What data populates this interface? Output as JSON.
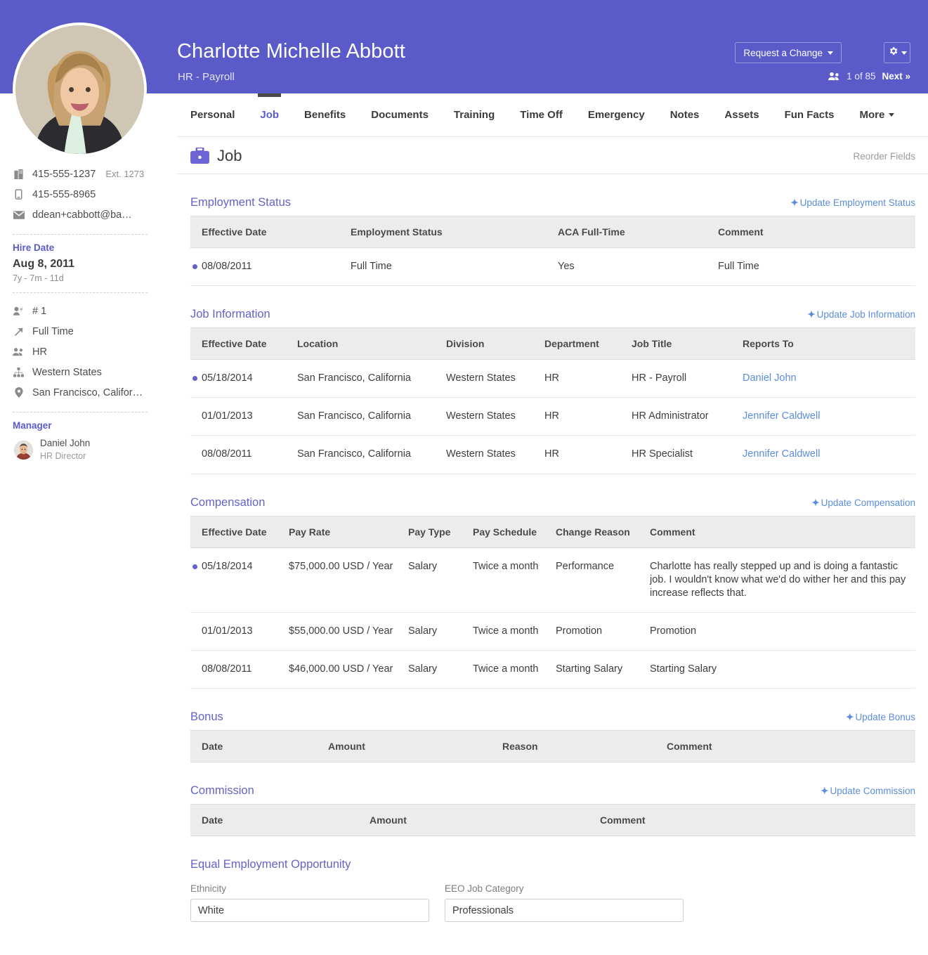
{
  "header": {
    "name": "Charlotte Michelle Abbott",
    "subtitle": "HR - Payroll",
    "request_change_label": "Request a Change",
    "gear_icon": "gear-icon",
    "people_icon": "people-icon",
    "record_count": "1 of 85",
    "next_label": "Next »",
    "band_color": "#5a5ac9"
  },
  "sidebar": {
    "work_phone": "415-555-1237",
    "work_phone_ext": "Ext. 1273",
    "mobile_phone": "415-555-8965",
    "email": "ddean+cabbott@ba…",
    "hire_date_label": "Hire Date",
    "hire_date": "Aug 8, 2011",
    "tenure": "7y - 7m - 11d",
    "employee_number": "# 1",
    "employment_type": "Full Time",
    "department": "HR",
    "division": "Western States",
    "location": "San Francisco, Califor…",
    "manager_label": "Manager",
    "manager_name": "Daniel John",
    "manager_title": "HR Director",
    "icons": {
      "work_phone": "office-phone-icon",
      "mobile_phone": "mobile-phone-icon",
      "email": "envelope-icon",
      "employee_number": "person-number-icon",
      "employment_type": "arrow-up-right-icon",
      "department": "people-icon",
      "division": "org-chart-icon",
      "location": "map-pin-icon"
    }
  },
  "tabs": [
    {
      "label": "Personal",
      "active": false
    },
    {
      "label": "Job",
      "active": true
    },
    {
      "label": "Benefits",
      "active": false
    },
    {
      "label": "Documents",
      "active": false
    },
    {
      "label": "Training",
      "active": false
    },
    {
      "label": "Time Off",
      "active": false
    },
    {
      "label": "Emergency",
      "active": false
    },
    {
      "label": "Notes",
      "active": false
    },
    {
      "label": "Assets",
      "active": false
    },
    {
      "label": "Fun Facts",
      "active": false
    },
    {
      "label": "More",
      "active": false
    }
  ],
  "page_header": {
    "icon": "briefcase-icon",
    "title": "Job",
    "reorder_label": "Reorder Fields"
  },
  "employment_status": {
    "title": "Employment Status",
    "action": "Update Employment Status",
    "columns": [
      "Effective Date",
      "Employment Status",
      "ACA Full-Time",
      "Comment"
    ],
    "rows": [
      {
        "current": true,
        "cells": [
          "08/08/2011",
          "Full Time",
          "Yes",
          "Full Time"
        ]
      }
    ]
  },
  "job_information": {
    "title": "Job Information",
    "action": "Update Job Information",
    "columns": [
      "Effective Date",
      "Location",
      "Division",
      "Department",
      "Job Title",
      "Reports To"
    ],
    "rows": [
      {
        "current": true,
        "cells": [
          "05/18/2014",
          "San Francisco, California",
          "Western States",
          "HR",
          "HR - Payroll",
          "Daniel John"
        ]
      },
      {
        "current": false,
        "cells": [
          "01/01/2013",
          "San Francisco, California",
          "Western States",
          "HR",
          "HR Administrator",
          "Jennifer Caldwell"
        ]
      },
      {
        "current": false,
        "cells": [
          "08/08/2011",
          "San Francisco, California",
          "Western States",
          "HR",
          "HR Specialist",
          "Jennifer Caldwell"
        ]
      }
    ]
  },
  "compensation": {
    "title": "Compensation",
    "action": "Update Compensation",
    "columns": [
      "Effective Date",
      "Pay Rate",
      "Pay Type",
      "Pay Schedule",
      "Change Reason",
      "Comment"
    ],
    "rows": [
      {
        "current": true,
        "cells": [
          "05/18/2014",
          "$75,000.00 USD / Year",
          "Salary",
          "Twice a month",
          "Performance",
          "Charlotte has really stepped up and is doing a fantastic job. I wouldn't know what we'd do wither her and this pay increase reflects that."
        ]
      },
      {
        "current": false,
        "cells": [
          "01/01/2013",
          "$55,000.00 USD / Year",
          "Salary",
          "Twice a month",
          "Promotion",
          "Promotion"
        ]
      },
      {
        "current": false,
        "cells": [
          "08/08/2011",
          "$46,000.00 USD / Year",
          "Salary",
          "Twice a month",
          "Starting Salary",
          "Starting Salary"
        ]
      }
    ]
  },
  "bonus": {
    "title": "Bonus",
    "action": "Update Bonus",
    "columns": [
      "Date",
      "Amount",
      "Reason",
      "Comment"
    ],
    "rows": []
  },
  "commission": {
    "title": "Commission",
    "action": "Update Commission",
    "columns": [
      "Date",
      "Amount",
      "Comment"
    ],
    "rows": []
  },
  "eeo": {
    "title": "Equal Employment Opportunity",
    "ethnicity_label": "Ethnicity",
    "ethnicity_value": "White",
    "category_label": "EEO Job Category",
    "category_value": "Professionals"
  },
  "colors": {
    "brand_purple": "#5a5ac9",
    "section_heading": "#6363c8",
    "link_blue": "#5b8dd9",
    "table_header_bg": "#ececec"
  }
}
